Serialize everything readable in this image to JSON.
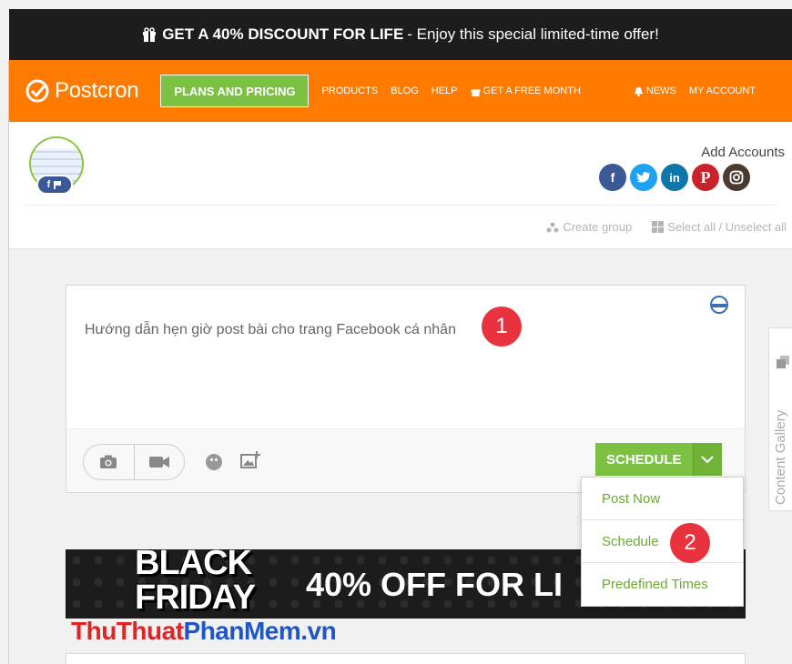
{
  "promo": {
    "bold": "GET A 40% DISCOUNT FOR LIFE",
    "rest": "- Enjoy this special limited-time offer!"
  },
  "nav": {
    "logo": "Postcron",
    "plans": "PLANS AND PRICING",
    "links": [
      "PRODUCTS",
      "BLOG",
      "HELP",
      "GET A FREE MONTH",
      "NEWS",
      "MY ACCOUNT"
    ]
  },
  "accounts": {
    "add_label": "Add Accounts",
    "badge": "f",
    "social": [
      {
        "name": "facebook-icon",
        "glyph": "f",
        "color": "#3b5998"
      },
      {
        "name": "twitter-icon",
        "glyph": "t",
        "color": "#1da1f2"
      },
      {
        "name": "linkedin-icon",
        "glyph": "in",
        "color": "#0e76a8"
      },
      {
        "name": "pinterest-icon",
        "glyph": "P",
        "color": "#c8232c"
      },
      {
        "name": "instagram-icon",
        "glyph": "◎",
        "color": "#4a3b32"
      }
    ],
    "create_group": "Create group",
    "select_all": "Select all / Unselect all"
  },
  "composer": {
    "text": "Hướng dẫn hẹn giờ post bài cho trang Facebook cá nhân",
    "step1": "1",
    "schedule": "SCHEDULE"
  },
  "dropdown": {
    "items": [
      "Post Now",
      "Schedule",
      "Predefined Times"
    ],
    "step2": "2"
  },
  "gallery": "Content Gallery",
  "banner": {
    "line1": "BLACK",
    "line2": "FRIDAY",
    "offer": "40% OFF FOR LI"
  },
  "watermark": {
    "a": "ThuThuat",
    "b": "PhanMem",
    "c": ".vn"
  },
  "colors": {
    "orange": "#ff7b00",
    "green": "#7cc142",
    "red": "#e8323d"
  }
}
